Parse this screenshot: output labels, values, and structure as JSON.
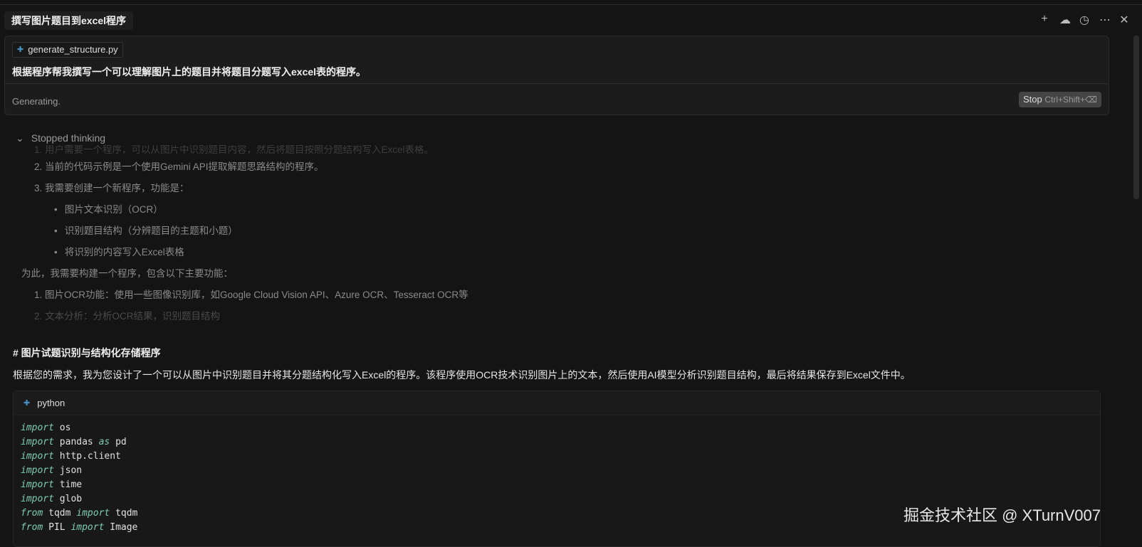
{
  "header": {
    "title": "撰写图片题目到excel程序",
    "icons": [
      "plus-icon",
      "cloud-icon",
      "history-icon",
      "more-icon",
      "close-icon"
    ]
  },
  "composer": {
    "file": "generate_structure.py",
    "prompt": "根据程序帮我撰写一个可以理解图片上的题目并将题目分题写入excel表的程序。",
    "status": "Generating.",
    "stop_label": "Stop",
    "stop_shortcut": "Ctrl+Shift+⌫"
  },
  "thinking": {
    "label": "Stopped thinking",
    "lines": [
      "1. 用户需要一个程序，可以从图片中识别题目内容，然后将题目按照分题结构写入Excel表格。",
      "2. 当前的代码示例是一个使用Gemini API提取解题思路结构的程序。",
      "3. 我需要创建一个新程序，功能是："
    ],
    "bullets": [
      "图片文本识别（OCR）",
      "识别题目结构（分辨题目的主题和小题）",
      "将识别的内容写入Excel表格"
    ],
    "para": "为此，我需要构建一个程序，包含以下主要功能：",
    "lines2": [
      "1. 图片OCR功能：使用一些图像识别库，如Google Cloud Vision API、Azure OCR、Tesseract OCR等",
      "2. 文本分析：分析OCR结果，识别题目结构"
    ]
  },
  "response": {
    "heading": "# 图片试题识别与结构化存储程序",
    "desc": "根据您的需求，我为您设计了一个可以从图片中识别题目并将其分题结构化写入Excel的程序。该程序使用OCR技术识别图片上的文本，然后使用AI模型分析识别题目结构，最后将结果保存到Excel文件中。"
  },
  "code": {
    "language": "python",
    "lines": [
      [
        "import",
        " os"
      ],
      [
        "import",
        " pandas ",
        "as",
        " pd"
      ],
      [
        "import",
        " http.client"
      ],
      [
        "import",
        " json"
      ],
      [
        "import",
        " time"
      ],
      [
        "import",
        " glob"
      ],
      [
        "from",
        " tqdm ",
        "import",
        " tqdm"
      ],
      [
        "from",
        " PIL ",
        "import",
        " Image"
      ]
    ]
  },
  "watermark": "掘金技术社区 @ XTurnV007"
}
